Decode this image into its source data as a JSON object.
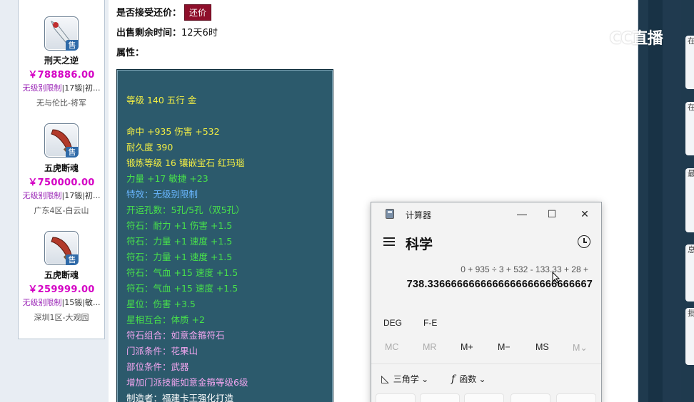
{
  "sidebar": {
    "items": [
      {
        "name": "刑天之逆",
        "price": "￥788886.00",
        "tag1": "无级别限制",
        "tag2": "|17锻",
        "tag3": "|初...",
        "server": "无与伦比-将军",
        "sell": "售"
      },
      {
        "name": "五虎断魂",
        "price": "￥750000.00",
        "tag1": "无级别限制",
        "tag2": "|17锻",
        "tag3": "|初...",
        "server": "广东4区-白云山",
        "sell": "售"
      },
      {
        "name": "五虎断魂",
        "price": "￥259999.00",
        "tag1": "无级别限制",
        "tag2": "|15锻",
        "tag3": "|敏...",
        "server": "深圳1区-大观园",
        "sell": "售"
      }
    ]
  },
  "main": {
    "accept_counter_label": "是否接受还价：",
    "counter_button": "还价",
    "time_left_label": "出售剩余时间：",
    "time_left_value": "12天6时",
    "attributes_label": "属性："
  },
  "attributes": [
    {
      "text": "等级 140 五行 金",
      "color": "yellow"
    },
    {
      "text": "命中 +935 伤害 +532",
      "color": "yellow"
    },
    {
      "text": "耐久度 390",
      "color": "yellow"
    },
    {
      "text": "锻炼等级 16 镶嵌宝石 红玛瑙",
      "color": "yellow"
    },
    {
      "text": "力量 +17 敏捷 +23",
      "color": "green"
    },
    {
      "text": "特效：无级别限制",
      "color": "blue"
    },
    {
      "text": "开运孔数：5孔/5孔（双5孔）",
      "color": "green"
    },
    {
      "text": "符石：耐力 +1 伤害 +1.5",
      "color": "green"
    },
    {
      "text": "符石：力量 +1 速度 +1.5",
      "color": "green"
    },
    {
      "text": "符石：力量 +1 速度 +1.5",
      "color": "green"
    },
    {
      "text": "符石：气血 +15 速度 +1.5",
      "color": "green"
    },
    {
      "text": "符石：气血 +15 速度 +1.5",
      "color": "green"
    },
    {
      "text": "星位：伤害 +3.5",
      "color": "green"
    },
    {
      "text": "星相互合：体质 +2",
      "color": "green"
    },
    {
      "text": "符石组合：如意金箍符石",
      "color": "pink"
    },
    {
      "text": "门派条件：花果山",
      "color": "pink"
    },
    {
      "text": "部位条件：武器",
      "color": "pink"
    },
    {
      "text": "增加门派技能如意金箍等级6级",
      "color": "pink"
    },
    {
      "text": "制造者：福建卡王强化打造",
      "color": "white"
    }
  ],
  "colors": {
    "yellow": "#f3ee43",
    "green": "#48e24a",
    "blue": "#69b6ff",
    "pink": "#f3a6f0",
    "white": "#ffffff"
  },
  "watermark": {
    "text": "CC直播"
  },
  "calculator": {
    "window_title": "计算器",
    "mode": "科学",
    "expression": "0 + 935 ÷ 3 + 532 - 133.33 + 28 +",
    "result": "738.3366666666666666666666666667",
    "toggles": [
      "DEG",
      "F-E"
    ],
    "memory": [
      "MC",
      "MR",
      "M+",
      "M−",
      "MS",
      "M⌄"
    ],
    "functions": [
      {
        "symbol": "◺",
        "label": "三角学 ⌄"
      },
      {
        "symbol": "f",
        "label": "函数 ⌄"
      }
    ],
    "window_buttons": {
      "minimize": "—",
      "maximize": "☐",
      "close": "✕"
    }
  },
  "right_strip": {
    "cards": [
      {
        "text": "在"
      },
      {
        "text": "在"
      },
      {
        "text": "最"
      },
      {
        "text": "息"
      },
      {
        "text": "批"
      }
    ]
  }
}
